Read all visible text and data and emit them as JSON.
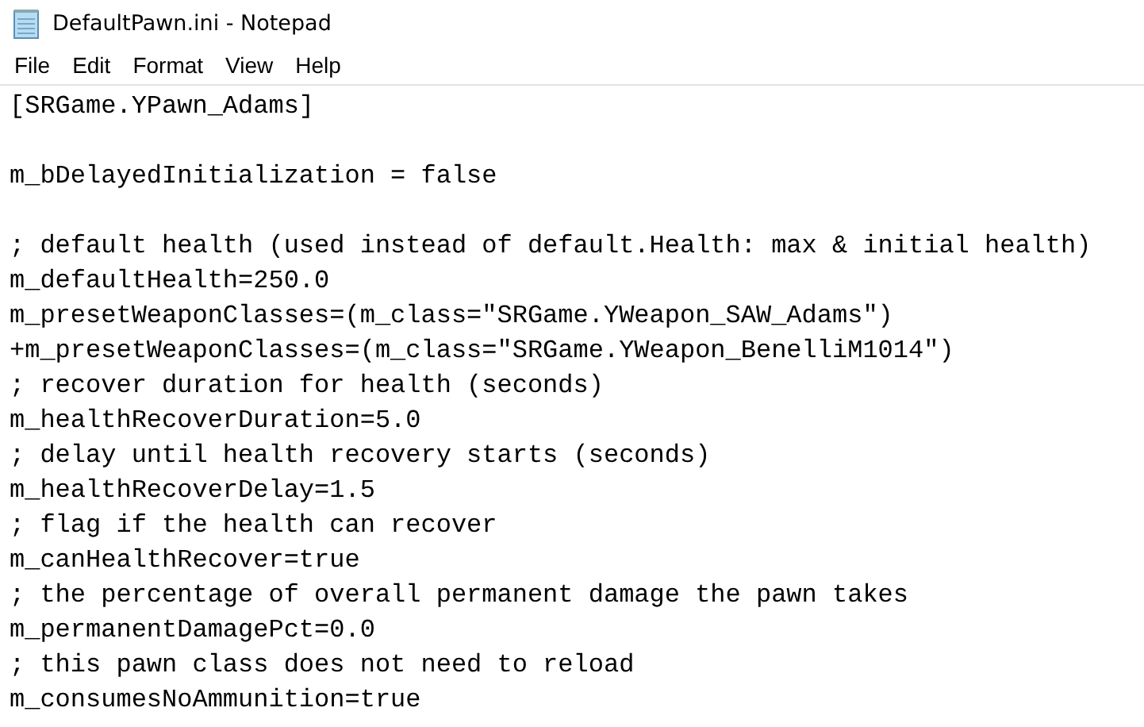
{
  "window": {
    "title": "DefaultPawn.ini - Notepad"
  },
  "menu": [
    "File",
    "Edit",
    "Format",
    "View",
    "Help"
  ],
  "lines": [
    {
      "kind": "text",
      "text": "[SRGame.YPawn_Adams]"
    },
    {
      "kind": "blank"
    },
    {
      "kind": "text",
      "text": "m_bDelayedInitialization = false"
    },
    {
      "kind": "blank"
    },
    {
      "kind": "text",
      "text": "; default health (used instead of default.Health: max & initial health)"
    },
    {
      "kind": "text",
      "text": "m_defaultHealth=250.0"
    },
    {
      "kind": "text",
      "text": "m_presetWeaponClasses=(m_class=\"SRGame.YWeapon_SAW_Adams\")"
    },
    {
      "kind": "text",
      "text": "+m_presetWeaponClasses=(m_class=\"SRGame.YWeapon_BenelliM1014\")"
    },
    {
      "kind": "text",
      "text": "; recover duration for health (seconds)"
    },
    {
      "kind": "text",
      "text": "m_healthRecoverDuration=5.0"
    },
    {
      "kind": "text",
      "text": "; delay until health recovery starts (seconds)"
    },
    {
      "kind": "text",
      "text": "m_healthRecoverDelay=1.5"
    },
    {
      "kind": "text",
      "text": "; flag if the health can recover"
    },
    {
      "kind": "text",
      "text": "m_canHealthRecover=true"
    },
    {
      "kind": "text",
      "text": "; the percentage of overall permanent damage the pawn takes"
    },
    {
      "kind": "text",
      "text": "m_permanentDamagePct=0.0"
    },
    {
      "kind": "text",
      "text": "; this pawn class does not need to reload"
    },
    {
      "kind": "text",
      "text": "m_consumesNoAmmunition=true"
    }
  ]
}
